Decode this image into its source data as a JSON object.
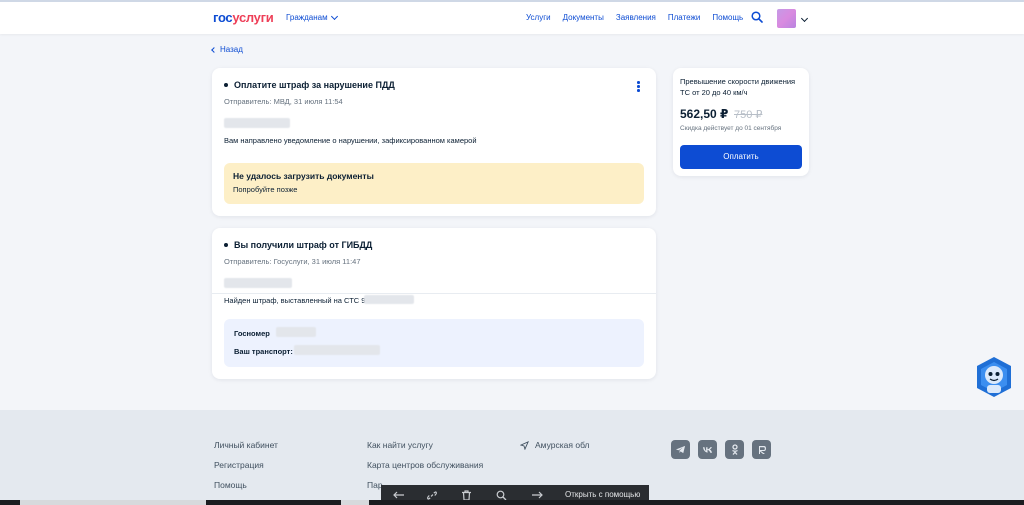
{
  "header": {
    "logo_part1": "гос",
    "logo_part2": "услуги",
    "citizens": "Гражданам",
    "nav": [
      "Услуги",
      "Документы",
      "Заявления",
      "Платежи",
      "Помощь"
    ]
  },
  "back": "Назад",
  "notice1": {
    "title": "Оплатите штраф за нарушение ПДД",
    "sender": "Отправитель: МВД, 31 июля 11:54",
    "text": "Вам направлено уведомление о нарушении, зафиксированном камерой",
    "warning_title": "Не удалось загрузить документы",
    "warning_sub": "Попробуйте позже"
  },
  "notice2": {
    "title": "Вы получили штраф от ГИБДД",
    "sender": "Отправитель: Госуслуги, 31 июля 11:47",
    "text": "Найден штраф, выставленный на СТС 9",
    "plate_label": "Госномер",
    "vehicle_label": "Ваш транспорт: "
  },
  "payment": {
    "title": "Превышение скорости движения ТС от 20 до 40 км/ч",
    "price": "562,50 ₽",
    "old_price": "750 ₽",
    "note": "Скидка действует до 01 сентября",
    "button": "Оплатить"
  },
  "footer": {
    "col1": [
      "Личный кабинет",
      "Регистрация",
      "Помощь"
    ],
    "col2": [
      "Как найти услугу",
      "Карта центров обслуживания",
      "Пар"
    ],
    "region": "Амурская обл",
    "socials": [
      "telegram-icon",
      "vk-icon",
      "odnoklassniki-icon",
      "rutube-icon"
    ]
  },
  "toolbar": {
    "text": "Открыть с помощью"
  },
  "colors": {
    "brand_blue": "#0d4cd3",
    "brand_red": "#ee3f58",
    "warning_bg": "#fdefc7",
    "info_bg": "#edf2fe",
    "page_bg": "#f3f5f9"
  }
}
